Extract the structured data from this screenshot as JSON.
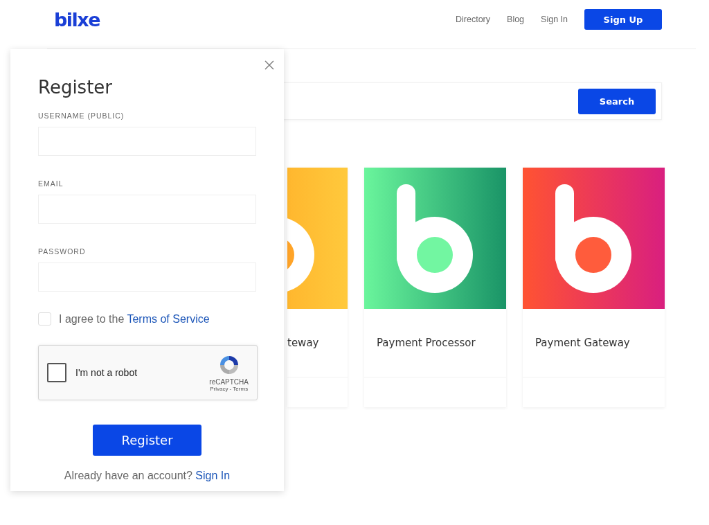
{
  "header": {
    "logo": "bilxe",
    "nav": [
      {
        "label": "Directory",
        "kind": "link"
      },
      {
        "label": "Blog",
        "kind": "link"
      },
      {
        "label": "Sign In",
        "kind": "link"
      },
      {
        "label": "Sign Up",
        "kind": "button"
      }
    ]
  },
  "search": {
    "button": "Search"
  },
  "cards": [
    {
      "title": "teway",
      "kind": "partial"
    },
    {
      "title": "Payment Processor",
      "kind": "full"
    },
    {
      "title": "Payment Gateway",
      "kind": "full"
    }
  ],
  "modal": {
    "title": "Register",
    "fields": [
      {
        "label": "USERNAME (PUBLIC)"
      },
      {
        "label": "EMAIL"
      },
      {
        "label": "PASSWORD"
      }
    ],
    "agree": {
      "text": "I agree to the",
      "link": "Terms of Service",
      "checked": false
    },
    "captcha": {
      "label": "I'm not a robot",
      "checked": false,
      "brand": "reCAPTCHA",
      "links": "Privacy - Terms"
    },
    "submit": "Register",
    "footer": {
      "text": "Already have an account?",
      "link": "Sign In"
    }
  }
}
